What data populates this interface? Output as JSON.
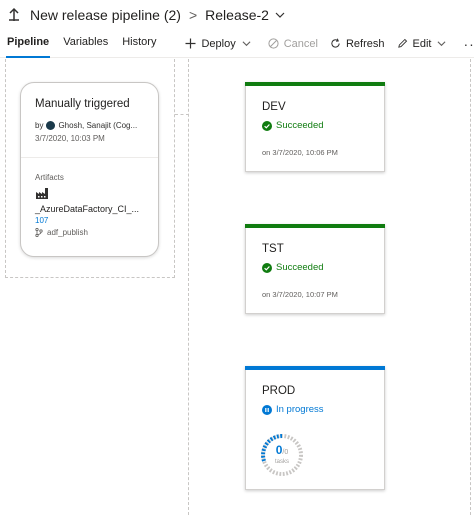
{
  "header": {
    "pipeline_name": "New release pipeline (2)",
    "separator": ">",
    "release_name": "Release-2"
  },
  "tabs": [
    {
      "label": "Pipeline",
      "active": true
    },
    {
      "label": "Variables",
      "active": false
    },
    {
      "label": "History",
      "active": false
    }
  ],
  "toolbar": {
    "deploy_label": "Deploy",
    "cancel_label": "Cancel",
    "refresh_label": "Refresh",
    "edit_label": "Edit",
    "more_label": "···"
  },
  "trigger": {
    "title": "Manually triggered",
    "by_prefix": "by",
    "user": "Ghosh, Sanajit (Cog...",
    "date": "3/7/2020, 10:03 PM",
    "artifacts_label": "Artifacts",
    "artifact_name": "_AzureDataFactory_CI_...",
    "artifact_version": "107",
    "artifact_branch": "adf_publish"
  },
  "stages": [
    {
      "name": "DEV",
      "status": "Succeeded",
      "when": "on 3/7/2020, 10:06 PM",
      "color": "#107c10"
    },
    {
      "name": "TST",
      "status": "Succeeded",
      "when": "on 3/7/2020, 10:07 PM",
      "color": "#107c10"
    },
    {
      "name": "PROD",
      "status": "In progress",
      "tasks_done": "0",
      "tasks_total": "/0",
      "tasks_label": "tasks",
      "color": "#0078d4"
    }
  ],
  "colors": {
    "accent": "#0078d4",
    "success": "#107c10"
  }
}
